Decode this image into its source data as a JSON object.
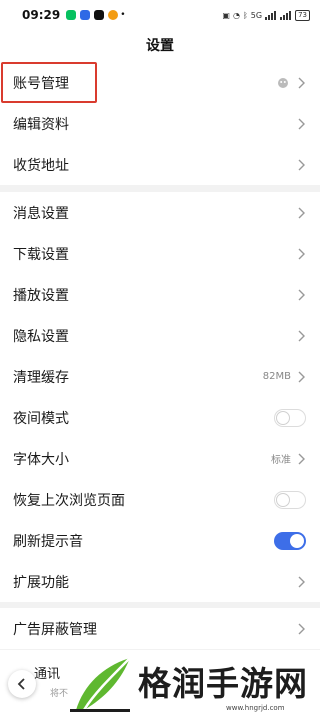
{
  "status_bar": {
    "time": "09:29",
    "indicator_dot": "•",
    "battery": "73",
    "network_text": "5G",
    "app_icons": [
      {
        "name": "wechat-icon",
        "color": "#07c160"
      },
      {
        "name": "mail-icon",
        "color": "#2f6ae6"
      },
      {
        "name": "tiktok-icon",
        "color": "#111111"
      },
      {
        "name": "browser-icon",
        "color": "#f39c12"
      }
    ]
  },
  "header": {
    "title": "设置"
  },
  "groups": [
    {
      "items": [
        {
          "label": "账号管理",
          "value": "",
          "has_avatar": true,
          "control": "chevron"
        },
        {
          "label": "编辑资料",
          "value": "",
          "control": "chevron"
        },
        {
          "label": "收货地址",
          "value": "",
          "control": "chevron"
        }
      ]
    },
    {
      "items": [
        {
          "label": "消息设置",
          "value": "",
          "control": "chevron"
        },
        {
          "label": "下载设置",
          "value": "",
          "control": "chevron"
        },
        {
          "label": "播放设置",
          "value": "",
          "control": "chevron"
        },
        {
          "label": "隐私设置",
          "value": "",
          "control": "chevron"
        },
        {
          "label": "清理缓存",
          "value": "82MB",
          "control": "chevron"
        },
        {
          "label": "夜间模式",
          "value": "",
          "control": "toggle",
          "on": false
        },
        {
          "label": "字体大小",
          "value": "标准",
          "control": "chevron"
        },
        {
          "label": "恢复上次浏览页面",
          "value": "",
          "control": "toggle",
          "on": false
        },
        {
          "label": "刷新提示音",
          "value": "",
          "control": "toggle",
          "on": true
        },
        {
          "label": "扩展功能",
          "value": "",
          "control": "chevron"
        }
      ]
    },
    {
      "items": [
        {
          "label": "广告屏蔽管理",
          "value": "",
          "control": "chevron"
        }
      ]
    }
  ],
  "partial_row": {
    "label": "通讯",
    "sub": "将不"
  },
  "watermark": {
    "text": "格润手游网",
    "url": "www.hngrjd.com"
  },
  "colors": {
    "accent": "#3d6ee8",
    "highlight": "#d93b2e",
    "watermark_green": "#5fb830"
  }
}
